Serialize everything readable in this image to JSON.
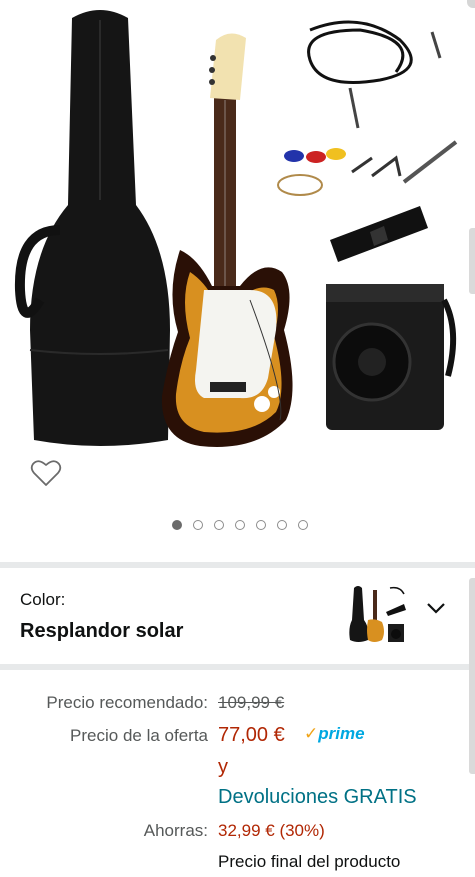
{
  "product": {
    "image_alt": "electric-guitar-kit",
    "carousel_count": 7,
    "carousel_active": 0
  },
  "color": {
    "label": "Color:",
    "value": "Resplandor solar"
  },
  "pricing": {
    "list_label": "Precio recomendado:",
    "list_price": "109,99 €",
    "deal_label": "Precio de la oferta",
    "deal_price": "77,00 €",
    "prime": "prime",
    "and_word": "y",
    "returns": "Devoluciones GRATIS",
    "savings_label": "Ahorras:",
    "savings_value": "32,99 € (30%)",
    "final_note": "Precio final del producto"
  },
  "colors": {
    "deal_red": "#b12704",
    "link_teal": "#007185",
    "prime_blue": "#00a8e1"
  }
}
